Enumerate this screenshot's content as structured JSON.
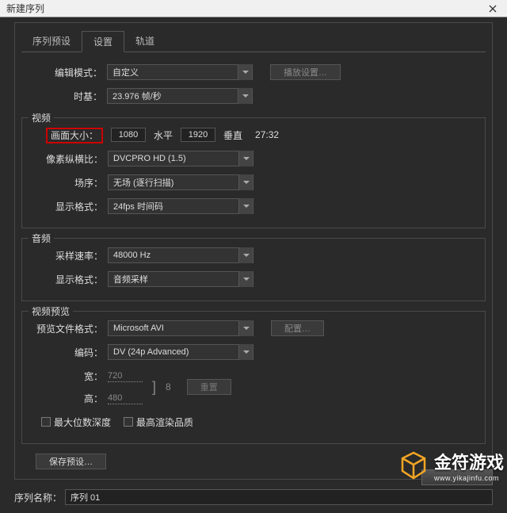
{
  "window": {
    "title": "新建序列"
  },
  "tabs": {
    "preset": "序列预设",
    "settings": "设置",
    "tracks": "轨道"
  },
  "general": {
    "edit_mode_label": "编辑模式：",
    "edit_mode_value": "自定义",
    "playback_btn": "播放设置…",
    "timebase_label": "时基：",
    "timebase_value": "23.976 帧/秒"
  },
  "video": {
    "section": "视频",
    "frame_size_label": "画面大小：",
    "width": "1080",
    "h_label": "水平",
    "height": "1920",
    "v_label": "垂直",
    "aspect": "27:32",
    "par_label": "像素纵横比：",
    "par_value": "DVCPRO HD (1.5)",
    "fields_label": "场序：",
    "fields_value": "无场 (逐行扫描)",
    "disp_label": "显示格式：",
    "disp_value": "24fps 时间码"
  },
  "audio": {
    "section": "音频",
    "rate_label": "采样速率：",
    "rate_value": "48000 Hz",
    "disp_label": "显示格式：",
    "disp_value": "音频采样"
  },
  "preview": {
    "section": "视频预览",
    "file_label": "预览文件格式：",
    "file_value": "Microsoft AVI",
    "config_btn": "配置…",
    "codec_label": "编码：",
    "codec_value": "DV (24p Advanced)",
    "width_label": "宽：",
    "width": "720",
    "height_label": "高：",
    "height": "480",
    "link": "8",
    "reset_btn": "重置",
    "max_depth": "最大位数深度",
    "max_quality": "最高渲染品质"
  },
  "save_preset_btn": "保存预设…",
  "seqname_label": "序列名称：",
  "seqname_value": "序列 01",
  "watermark": {
    "line1": "金符游戏",
    "line2": "www.yikajinfu.com"
  }
}
